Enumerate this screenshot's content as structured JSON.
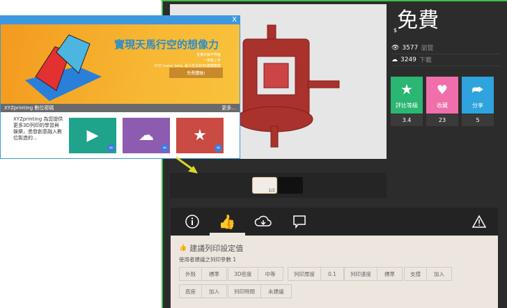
{
  "popup": {
    "close_label": "X",
    "headline": "實現天馬行空的想像力",
    "lines": [
      "直覺的操作界面",
      "一用就上手",
      "XYZ maker beta, 最人性化的3D建模軟體"
    ],
    "cta_label": "免費體驗!",
    "caption": "XYZprinting 數位密碼",
    "more_label": "更多...",
    "quote": "XYZprinting 為您提供更多3D列印的學習與娛樂，悉發創意融入數位製造的...",
    "tiles": [
      {
        "name": "video",
        "color": "#1fa38a"
      },
      {
        "name": "cloud-download",
        "color": "#8d5bb0"
      },
      {
        "name": "tools",
        "color": "#c94b43"
      }
    ]
  },
  "product": {
    "currency": "$",
    "price": "免費",
    "views": "3577",
    "views_label": "瀏覽",
    "downloads": "3249",
    "downloads_label": "下載",
    "actions": [
      {
        "label": "評比等級",
        "value": "3.4",
        "color": "#2bb673"
      },
      {
        "label": "收藏",
        "value": "23",
        "color": "#f06ea9"
      },
      {
        "label": "分享",
        "value": "5",
        "color": "#2ea3dd"
      }
    ],
    "thumb_counter": "1/2"
  },
  "tabs": [
    "info",
    "recommend",
    "download",
    "comments",
    "report"
  ],
  "settings": {
    "title": "建議列印設定值",
    "subtitle": "使用者建議之列印參數 1",
    "params": [
      {
        "k": "外殼",
        "v": "標準"
      },
      {
        "k": "3D密度",
        "v": "中等"
      },
      {
        "k": "列印厚度",
        "v": "0.1"
      },
      {
        "k": "列印速度",
        "v": "標準"
      },
      {
        "k": "支撐",
        "v": "加入"
      },
      {
        "k": "底座",
        "v": "加入"
      },
      {
        "k": "列印時間",
        "v": "未建議"
      }
    ]
  }
}
